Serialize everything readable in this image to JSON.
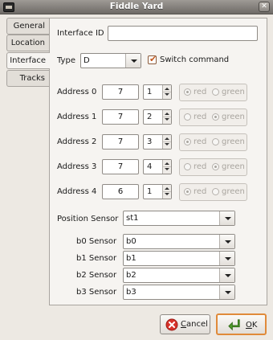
{
  "window": {
    "title": "Fiddle Yard"
  },
  "tabs": [
    {
      "label": "General"
    },
    {
      "label": "Location"
    },
    {
      "label": "Interface"
    },
    {
      "label": "Tracks"
    }
  ],
  "interface": {
    "interface_id_label": "Interface ID",
    "interface_id_value": "",
    "type_label": "Type",
    "type_value": "D",
    "switch_command_label": "Switch command",
    "switch_command_checked": true
  },
  "addresses": [
    {
      "label": "Address 0",
      "value": "7",
      "port": "1",
      "selected": "red"
    },
    {
      "label": "Address 1",
      "value": "7",
      "port": "2",
      "selected": "green"
    },
    {
      "label": "Address 2",
      "value": "7",
      "port": "3",
      "selected": "red"
    },
    {
      "label": "Address 3",
      "value": "7",
      "port": "4",
      "selected": "green"
    },
    {
      "label": "Address 4",
      "value": "6",
      "port": "1",
      "selected": "red"
    }
  ],
  "radio_labels": {
    "red": "red",
    "green": "green"
  },
  "position_sensor": {
    "label": "Position Sensor",
    "value": "st1"
  },
  "sensors": [
    {
      "label": "b0 Sensor",
      "value": "b0"
    },
    {
      "label": "b1 Sensor",
      "value": "b1"
    },
    {
      "label": "b2 Sensor",
      "value": "b2"
    },
    {
      "label": "b3 Sensor",
      "value": "b3"
    }
  ],
  "buttons": {
    "cancel_prefix": "",
    "cancel_accel": "C",
    "cancel_rest": "ancel",
    "ok_accel": "O",
    "ok_rest": "K"
  },
  "icons": {
    "close": "close-icon",
    "app": "app-icon",
    "cancel": "cancel-icon",
    "ok": "ok-icon"
  },
  "colors": {
    "accent": "#e08a3a",
    "cancel_icon": "#d8322a",
    "ok_icon": "#4e9a2a",
    "checkbox_mark": "#c4581c"
  }
}
